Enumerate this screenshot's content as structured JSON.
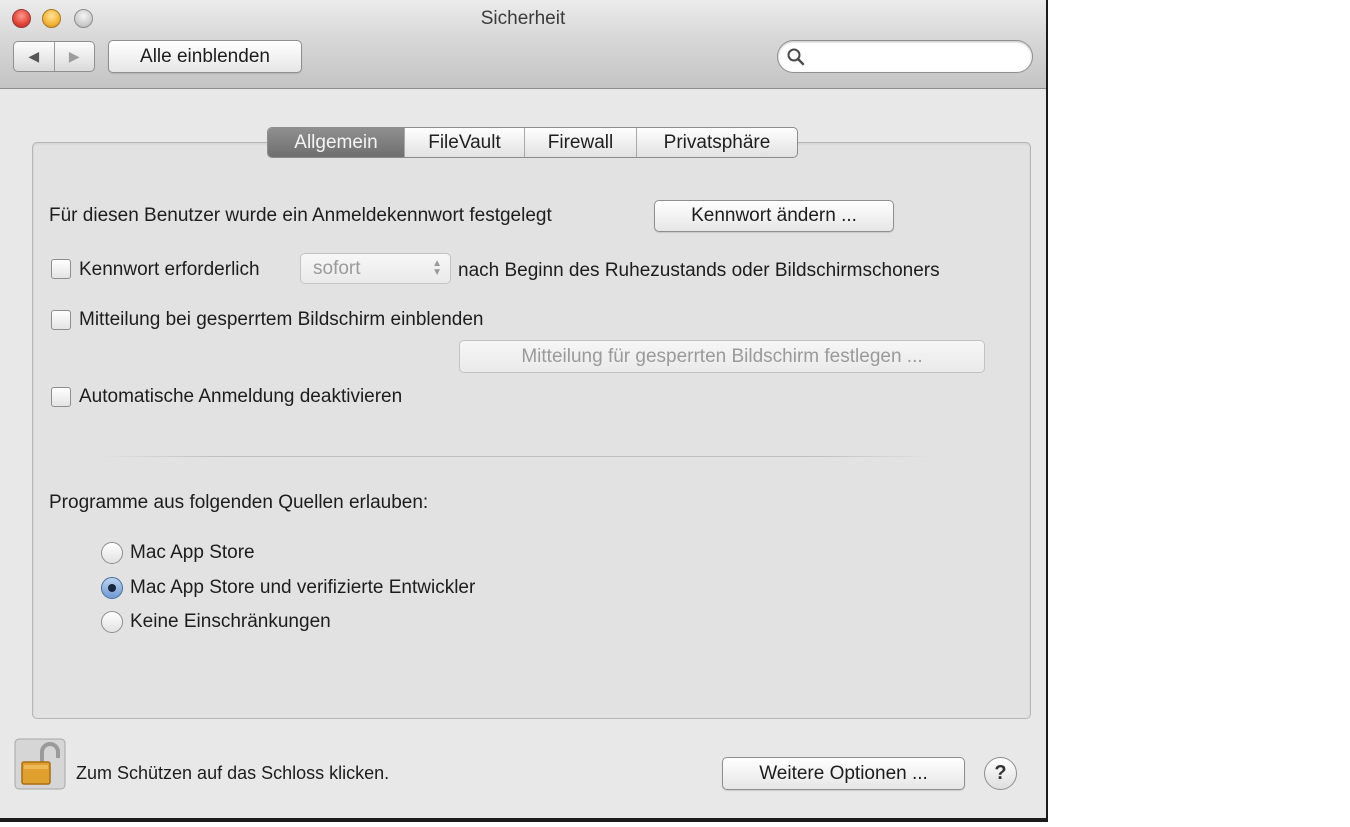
{
  "window": {
    "title": "Sicherheit"
  },
  "toolbar": {
    "back_icon": "◀",
    "forward_icon": "▶",
    "show_all_label": "Alle einblenden",
    "search": {
      "value": "",
      "placeholder": ""
    }
  },
  "tabs": [
    {
      "label": "Allgemein",
      "active": true
    },
    {
      "label": "FileVault",
      "active": false
    },
    {
      "label": "Firewall",
      "active": false
    },
    {
      "label": "Privatsphäre",
      "active": false
    }
  ],
  "general": {
    "password_set_text": "Für diesen Benutzer wurde ein Anmeldekennwort festgelegt",
    "change_password_label": "Kennwort ändern ...",
    "require_password": {
      "label": "Kennwort erforderlich",
      "checked": false,
      "delay_value": "sofort",
      "suffix": "nach Beginn des Ruhezustands oder Bildschirmschoners"
    },
    "lock_message": {
      "label": "Mitteilung bei gesperrtem Bildschirm einblenden",
      "checked": false,
      "set_button_label": "Mitteilung für gesperrten Bildschirm festlegen ..."
    },
    "disable_autologin": {
      "label": "Automatische Anmeldung deaktivieren",
      "checked": false
    }
  },
  "sources": {
    "heading": "Programme aus folgenden Quellen erlauben:",
    "options": [
      {
        "label": "Mac App Store",
        "selected": false
      },
      {
        "label": "Mac App Store und verifizierte Entwickler",
        "selected": true
      },
      {
        "label": "Keine Einschränkungen",
        "selected": false
      }
    ]
  },
  "footer": {
    "lock_text": "Zum Schützen auf das Schloss klicken.",
    "more_options_label": "Weitere Optionen ...",
    "help_label": "?"
  },
  "colors": {
    "active_tab": "#7f7f7f",
    "selected_radio": "#6f9ad3",
    "window_background": "#e8e8e8"
  }
}
